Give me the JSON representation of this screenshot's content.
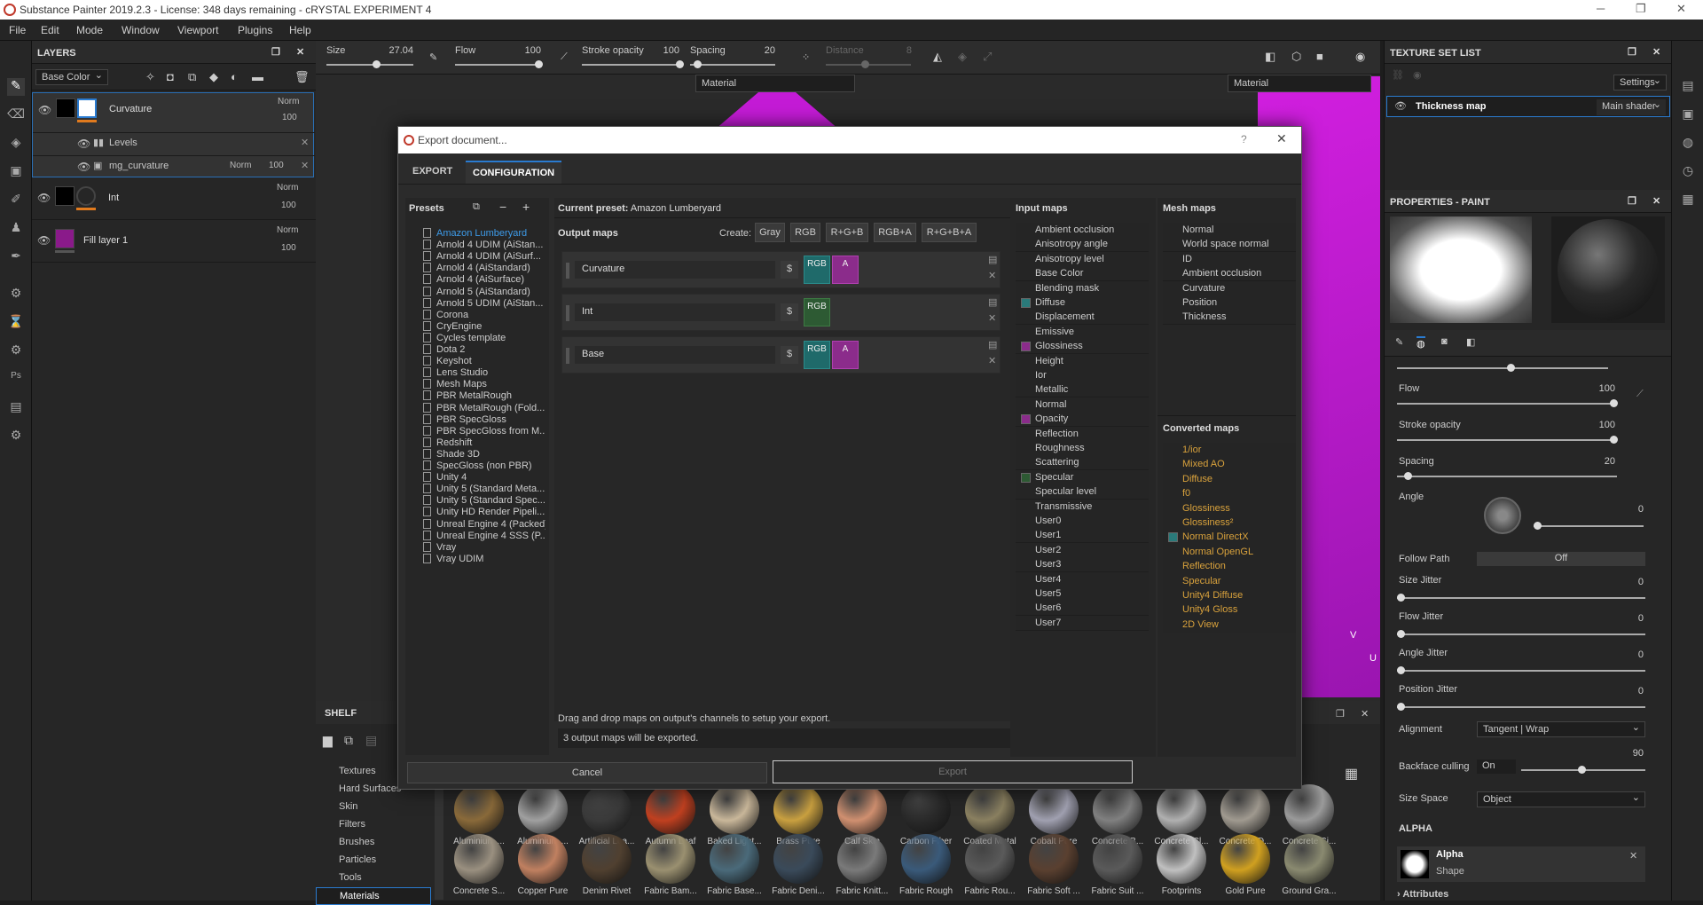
{
  "app": {
    "title": "Substance Painter 2019.2.3 - License: 348 days remaining - cRYSTAL EXPERIMENT 4",
    "menu": [
      "File",
      "Edit",
      "Mode",
      "Window",
      "Viewport",
      "Plugins",
      "Help"
    ]
  },
  "layers_panel": {
    "title": "LAYERS",
    "channel": "Base Color",
    "layers": [
      {
        "name": "Curvature",
        "blend": "Norm",
        "opacity": "100"
      },
      {
        "name": "Levels"
      },
      {
        "name": "mg_curvature",
        "blend": "Norm",
        "opacity": "100"
      },
      {
        "name": "Int",
        "blend": "Norm",
        "opacity": "100"
      },
      {
        "name": "Fill layer 1",
        "blend": "Norm",
        "opacity": "100"
      }
    ]
  },
  "toolbar": {
    "size_label": "Size",
    "size_value": "27.04",
    "flow_label": "Flow",
    "flow_value": "100",
    "stroke_label": "Stroke opacity",
    "stroke_value": "100",
    "spacing_label": "Spacing",
    "spacing_value": "20",
    "distance_label": "Distance",
    "distance_value": "8",
    "viewport_mode_left": "Material",
    "viewport_mode_right": "Material"
  },
  "shelf": {
    "title": "SHELF",
    "categories": [
      "Textures",
      "Hard Surfaces",
      "Skin",
      "Filters",
      "Brushes",
      "Particles",
      "Tools",
      "Materials"
    ],
    "row1": [
      "Aluminium ...",
      "Aluminium ...",
      "Artificial Lea...",
      "Autumn Leaf",
      "Baked Light...",
      "Brass Pure",
      "Calf Skin",
      "Carbon Fiber",
      "Coated Metal",
      "Cobalt Pure",
      "Concrete B...",
      "Concrete Cl...",
      "Concrete D...",
      "Concrete Si..."
    ],
    "row2": [
      "Concrete S...",
      "Copper Pure",
      "Denim Rivet",
      "Fabric Bam...",
      "Fabric Base...",
      "Fabric Deni...",
      "Fabric Knitt...",
      "Fabric Rough",
      "Fabric Rou...",
      "Fabric Soft ...",
      "Fabric Suit ...",
      "Footprints",
      "Gold Pure",
      "Ground Gra..."
    ]
  },
  "texture_set": {
    "title": "TEXTURE SET LIST",
    "settings": "Settings",
    "item": "Thickness map",
    "shader": "Main shader"
  },
  "properties": {
    "title": "PROPERTIES - PAINT",
    "flow_label": "Flow",
    "flow_value": "100",
    "stroke_label": "Stroke opacity",
    "stroke_value": "100",
    "spacing_label": "Spacing",
    "spacing_value": "20",
    "angle_label": "Angle",
    "angle_value": "0",
    "follow_label": "Follow Path",
    "follow_value": "Off",
    "size_jitter_label": "Size Jitter",
    "size_jitter_value": "0",
    "flow_jitter_label": "Flow Jitter",
    "flow_jitter_value": "0",
    "angle_jitter_label": "Angle Jitter",
    "angle_jitter_value": "0",
    "pos_jitter_label": "Position Jitter",
    "pos_jitter_value": "0",
    "alignment_label": "Alignment",
    "alignment_value": "Tangent | Wrap",
    "backface_label": "Backface culling",
    "backface_value": "On",
    "backface_angle": "90",
    "size_space_label": "Size Space",
    "size_space_value": "Object",
    "alpha_header": "ALPHA",
    "alpha_name": "Alpha",
    "alpha_type": "Shape",
    "attributes": "Attributes"
  },
  "dialog": {
    "title": "Export document...",
    "tab_export": "EXPORT",
    "tab_config": "CONFIGURATION",
    "presets_label": "Presets",
    "current_preset_label": "Current preset:",
    "current_preset": "Amazon Lumberyard",
    "output_maps_label": "Output maps",
    "create_label": "Create:",
    "create_buttons": [
      "Gray",
      "RGB",
      "R+G+B",
      "RGB+A",
      "R+G+B+A"
    ],
    "presets": [
      "Amazon Lumberyard",
      "Arnold 4  UDIM (AiStan...",
      "Arnold 4  UDIM (AiSurf...",
      "Arnold 4 (AiStandard)",
      "Arnold 4 (AiSurface)",
      "Arnold 5 (AiStandard)",
      "Arnold 5 UDIM (AiStan...",
      "Corona",
      "CryEngine",
      "Cycles template",
      "Dota 2",
      "Keyshot",
      "Lens Studio",
      "Mesh Maps",
      "PBR MetalRough",
      "PBR MetalRough (Fold...",
      "PBR SpecGloss",
      "PBR SpecGloss from M...",
      "Redshift",
      "Shade 3D",
      "SpecGloss (non PBR)",
      "Unity 4",
      "Unity 5 (Standard Meta...",
      "Unity 5 (Standard Spec...",
      "Unity HD Render Pipeli...",
      "Unreal Engine 4 (Packed)",
      "Unreal Engine 4 SSS (P...",
      "Vray",
      "Vray UDIM"
    ],
    "output_maps": [
      {
        "name": "Curvature",
        "ch1": "RGB",
        "ch2": "A"
      },
      {
        "name": "Int",
        "ch1": "RGB",
        "ch2": ""
      },
      {
        "name": "Base",
        "ch1": "RGB",
        "ch2": "A"
      }
    ],
    "dollar": "$",
    "input_maps_label": "Input maps",
    "input_maps": [
      "Ambient occlusion",
      "Anisotropy angle",
      "Anisotropy level",
      "Base Color",
      "Blending mask",
      "Diffuse",
      "Displacement",
      "Emissive",
      "Glossiness",
      "Height",
      "Ior",
      "Metallic",
      "Normal",
      "Opacity",
      "Reflection",
      "Roughness",
      "Scattering",
      "Specular",
      "Specular level",
      "Transmissive",
      "User0",
      "User1",
      "User2",
      "User3",
      "User4",
      "User5",
      "User6",
      "User7"
    ],
    "mesh_maps_label": "Mesh maps",
    "mesh_maps": [
      "Normal",
      "World space normal",
      "ID",
      "Ambient occlusion",
      "Curvature",
      "Position",
      "Thickness"
    ],
    "converted_maps_label": "Converted maps",
    "converted_maps": [
      "1/ior",
      "Mixed AO",
      "Diffuse",
      "f0",
      "Glossiness",
      "Glossiness²",
      "Normal DirectX",
      "Normal OpenGL",
      "Reflection",
      "Specular",
      "Unity4 Diffuse",
      "Unity4 Gloss",
      "2D View"
    ],
    "hint": "Drag and drop maps on output's channels to setup your export.",
    "status": "3 output maps will be exported.",
    "cancel": "Cancel",
    "export": "Export"
  },
  "colors": {
    "accent": "#2a7bd0",
    "magenta": "#c41bd6",
    "orange": "#e07a1e"
  },
  "viewport_axes": {
    "v": "V",
    "u": "U"
  }
}
